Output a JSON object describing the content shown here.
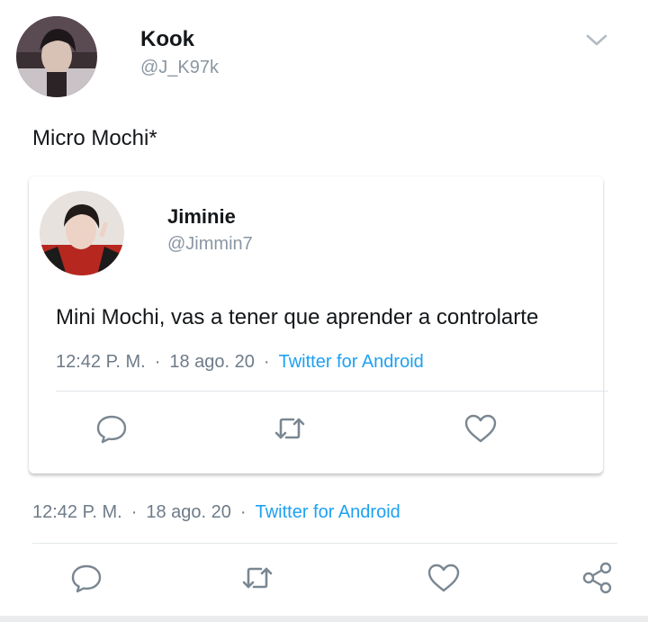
{
  "tweet": {
    "author": {
      "name": "Kook",
      "handle": "@J_K97k"
    },
    "text": "Micro Mochi*",
    "meta": {
      "time": "12:42 P. M.",
      "separator": "·",
      "date": "18 ago. 20",
      "source": "Twitter for Android"
    }
  },
  "quoted_tweet": {
    "author": {
      "name": "Jiminie",
      "handle": "@Jimmin7"
    },
    "text": "Mini Mochi, vas a tener que aprender a controlarte",
    "meta": {
      "time": "12:42 P. M.",
      "separator": "·",
      "date": "18 ago. 20",
      "source": "Twitter for Android"
    }
  },
  "icons": {
    "menu": "chevron-down-icon",
    "reply": "reply-icon",
    "retweet": "retweet-icon",
    "like": "heart-icon",
    "share": "share-icon"
  },
  "colors": {
    "text_primary": "#14171a",
    "text_secondary": "#8a96a3",
    "link": "#1da1f2",
    "icon": "#7a8792"
  }
}
